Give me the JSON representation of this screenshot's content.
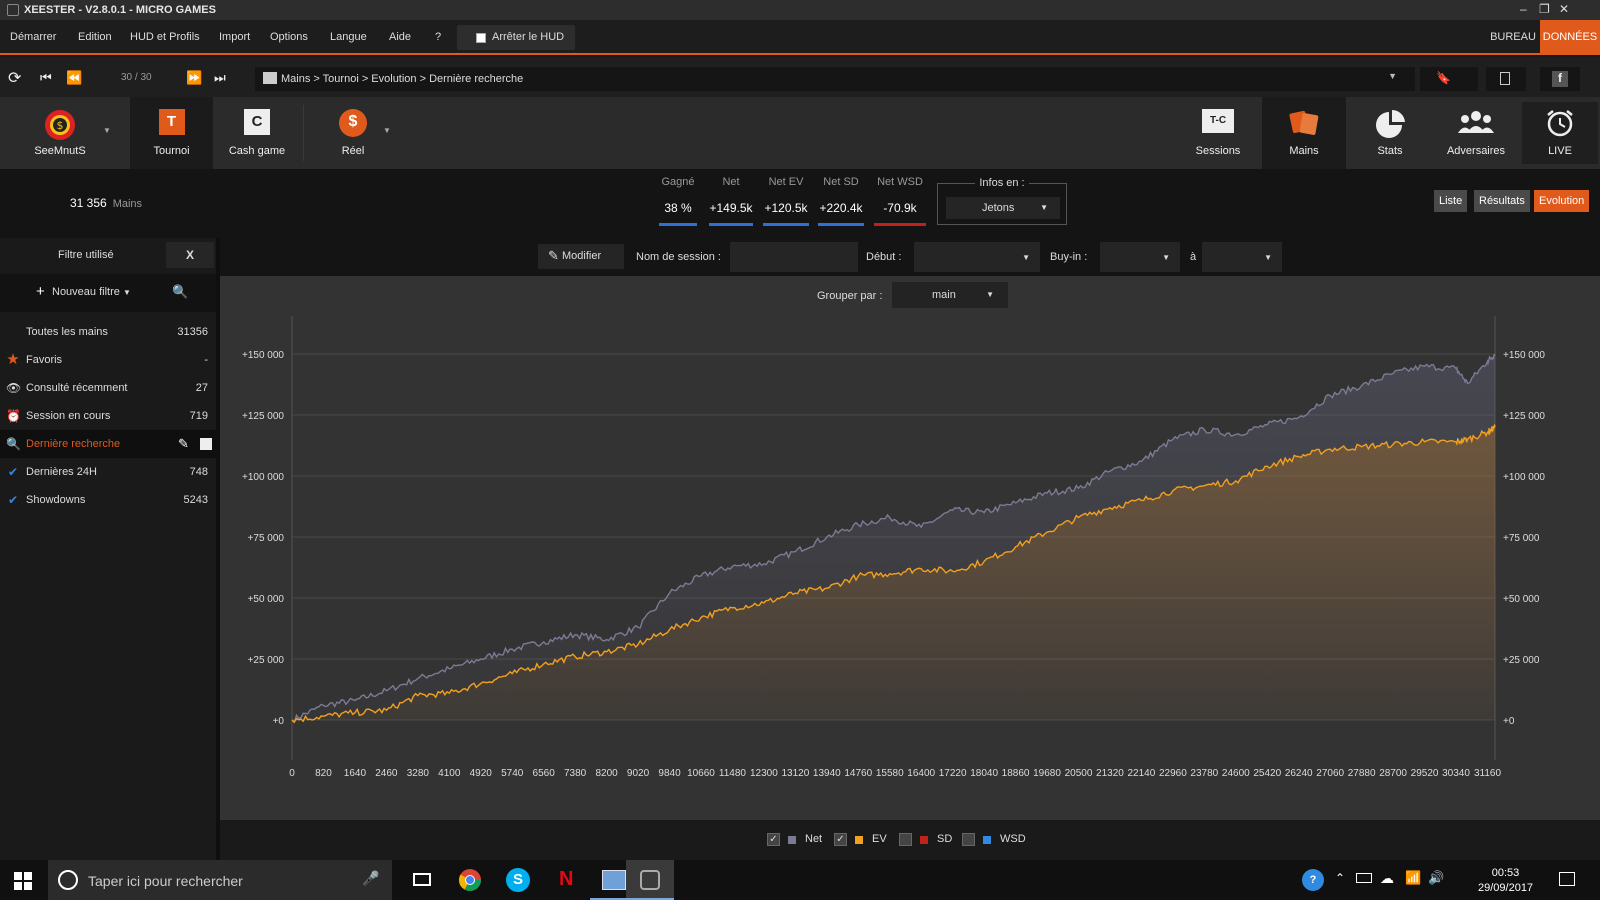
{
  "window": {
    "title": "XEESTER - V2.8.0.1 - MICRO GAMES"
  },
  "menu": {
    "items": [
      "Démarrer",
      "Edition",
      "HUD et Profils",
      "Import",
      "Options",
      "Langue",
      "Aide",
      "?"
    ],
    "hud_toggle": "Arrêter le HUD",
    "bureau": "BUREAU",
    "donnees": "DONNÉES"
  },
  "nav": {
    "pager": "30 / 30",
    "breadcrumb": "Mains > Tournoi > Evolution > Dernière recherche"
  },
  "toolbar": {
    "left": [
      {
        "label": "SeeMnutS",
        "icon": "player-chip-icon"
      },
      {
        "label": "Tournoi",
        "icon": "tournament-icon",
        "letter": "T"
      },
      {
        "label": "Cash game",
        "icon": "cash-game-icon",
        "letter": "C"
      },
      {
        "label": "Réel",
        "icon": "real-money-icon",
        "letter": "$"
      }
    ],
    "right": [
      {
        "label": "Sessions",
        "icon": "sessions-icon",
        "tag": "T-C"
      },
      {
        "label": "Mains",
        "icon": "hands-icon"
      },
      {
        "label": "Stats",
        "icon": "stats-pie-icon"
      },
      {
        "label": "Adversaires",
        "icon": "opponents-icon"
      },
      {
        "label": "LIVE",
        "icon": "alarm-clock-icon"
      }
    ]
  },
  "summary": {
    "mains_count": "31 356",
    "mains_unit": "Mains",
    "stats": [
      {
        "header": "Gagné",
        "value": "38 %",
        "color": "#2f6fd8"
      },
      {
        "header": "Net",
        "value": "+149.5k",
        "color": "#2f6fd8"
      },
      {
        "header": "Net EV",
        "value": "+120.5k",
        "color": "#2f6fd8"
      },
      {
        "header": "Net SD",
        "value": "+220.4k",
        "color": "#2f6fd8"
      },
      {
        "header": "Net WSD",
        "value": "-70.9k",
        "color": "#c0221b"
      }
    ],
    "infos_en": "Infos en :",
    "infos_value": "Jetons",
    "views": [
      "Liste",
      "Résultats",
      "Evolution"
    ]
  },
  "sidebar": {
    "filter_label": "Filtre utilisé",
    "clear": "X",
    "new_filter": "Nouveau filtre",
    "items": [
      {
        "label": "Toutes les mains",
        "count": "31356",
        "icon": ""
      },
      {
        "label": "Favoris",
        "count": "-",
        "icon": "star-icon"
      },
      {
        "label": "Consulté récemment",
        "count": "27",
        "icon": "eye-icon"
      },
      {
        "label": "Session en cours",
        "count": "719",
        "icon": "alarm-icon"
      },
      {
        "label": "Dernière recherche",
        "count": "",
        "icon": "search-icon"
      },
      {
        "label": "Dernières 24H",
        "count": "748",
        "icon": "check-icon"
      },
      {
        "label": "Showdowns",
        "count": "5243",
        "icon": "check-icon"
      }
    ]
  },
  "filterbar": {
    "modifier": "Modifier",
    "session_label": "Nom de session :",
    "debut_label": "Début :",
    "buyin_label": "Buy-in :",
    "a_label": "à",
    "group_label": "Grouper par :",
    "group_value": "main"
  },
  "chart_data": {
    "type": "line",
    "x_ticks": [
      0,
      820,
      1640,
      2460,
      3280,
      4100,
      4920,
      5740,
      6560,
      7380,
      8200,
      9020,
      9840,
      10660,
      11480,
      12300,
      13120,
      13940,
      14760,
      15580,
      16400,
      17220,
      18040,
      18860,
      19680,
      20500,
      21320,
      22140,
      22960,
      23780,
      24600,
      25420,
      26240,
      27060,
      27880,
      28700,
      29520,
      30340,
      31160
    ],
    "y_ticks": [
      "+0",
      "+25 000",
      "+50 000",
      "+75 000",
      "+100 000",
      "+125 000",
      "+150 000"
    ],
    "xlim": [
      0,
      31356
    ],
    "ylim": [
      0,
      150000
    ],
    "series": [
      {
        "name": "Net",
        "color": "#7b7b94",
        "x": [
          0,
          820,
          1640,
          2460,
          3280,
          4100,
          4920,
          5740,
          6560,
          7380,
          8200,
          9020,
          9840,
          10660,
          11480,
          12300,
          13120,
          13940,
          14760,
          15580,
          16400,
          17220,
          18040,
          18860,
          19680,
          20500,
          21320,
          22140,
          22960,
          23780,
          24600,
          25420,
          26240,
          27060,
          27880,
          28700,
          29520,
          30340,
          30640,
          31160,
          31356
        ],
        "y": [
          0,
          6000,
          8000,
          12000,
          17000,
          21000,
          25000,
          29000,
          32000,
          35000,
          33000,
          38000,
          52000,
          59000,
          63000,
          64000,
          69000,
          75000,
          80000,
          83000,
          79000,
          86000,
          85000,
          89000,
          93000,
          95000,
          102000,
          106000,
          115000,
          119000,
          117000,
          121000,
          124000,
          133000,
          137000,
          142000,
          145000,
          144000,
          138000,
          147000,
          150000
        ]
      },
      {
        "name": "EV",
        "color": "#f2a01e",
        "x": [
          0,
          820,
          1640,
          2460,
          3280,
          4100,
          4920,
          5740,
          6560,
          7380,
          8200,
          9020,
          9840,
          10660,
          11480,
          12300,
          13120,
          13940,
          14760,
          15580,
          16400,
          17220,
          18040,
          18860,
          19680,
          20500,
          21320,
          22140,
          22960,
          23780,
          24600,
          25420,
          26240,
          27060,
          27880,
          28700,
          29520,
          30340,
          30640,
          31160,
          31356
        ],
        "y": [
          0,
          1500,
          3000,
          4000,
          10000,
          11000,
          15000,
          19000,
          23000,
          26000,
          28000,
          31000,
          37000,
          42000,
          46000,
          48000,
          52000,
          54000,
          59000,
          60000,
          62000,
          61000,
          65000,
          71000,
          77000,
          83000,
          87000,
          90000,
          94000,
          96000,
          98000,
          104000,
          108000,
          111000,
          112000,
          113000,
          114000,
          114000,
          115000,
          118000,
          120000
        ]
      },
      {
        "name": "SD",
        "color": "#c0221b",
        "x": [],
        "y": []
      },
      {
        "name": "WSD",
        "color": "#2f8ae0",
        "x": [],
        "y": []
      }
    ]
  },
  "legend": [
    {
      "name": "Net",
      "checked": true,
      "color": "#7b7b94"
    },
    {
      "name": "EV",
      "checked": true,
      "color": "#f2a01e"
    },
    {
      "name": "SD",
      "checked": false,
      "color": "#c0221b"
    },
    {
      "name": "WSD",
      "checked": false,
      "color": "#2f8ae0"
    }
  ],
  "taskbar": {
    "search_placeholder": "Taper ici pour rechercher",
    "time": "00:53",
    "date": "29/09/2017"
  }
}
